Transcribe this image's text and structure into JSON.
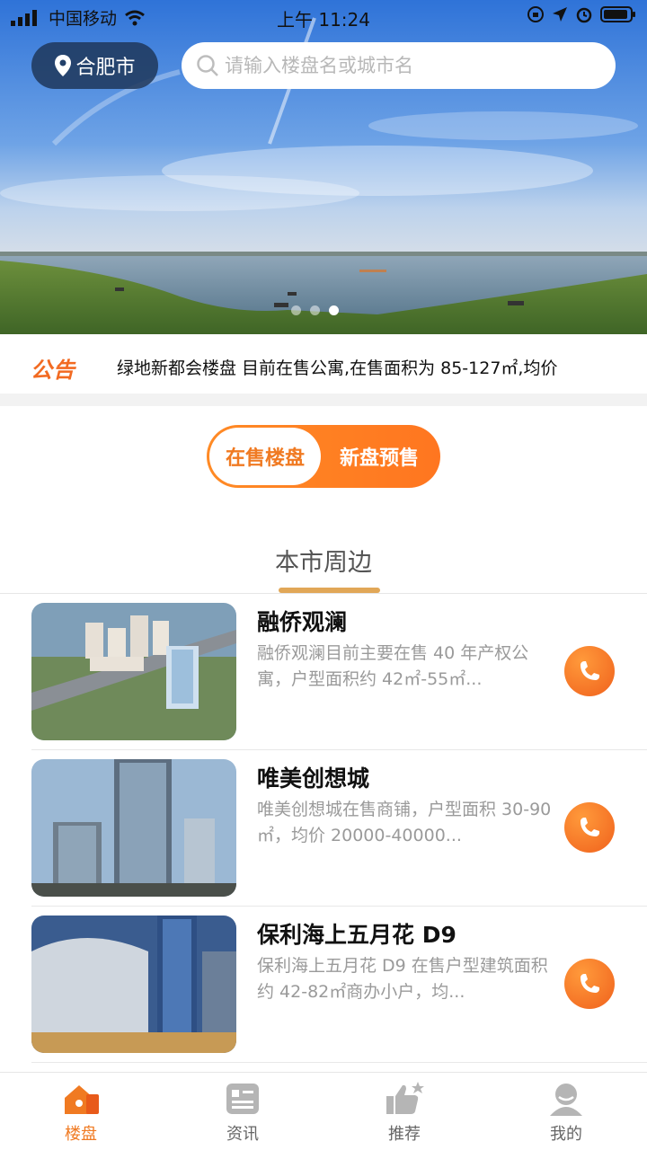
{
  "status_bar": {
    "carrier": "中国移动",
    "time": "上午 11:24"
  },
  "header": {
    "city": "合肥市",
    "search_placeholder": "请输入楼盘名或城市名"
  },
  "carousel": {
    "count": 3,
    "active_index": 2
  },
  "notice": {
    "badge": "公告",
    "text": "绿地新都会楼盘 目前在售公寓,在售面积为 85-127㎡,均价"
  },
  "toggle": {
    "on_sale": "在售楼盘",
    "presale": "新盘预售",
    "selected": "on_sale"
  },
  "section": {
    "title": "本市周边"
  },
  "listings": [
    {
      "title": "融侨观澜",
      "desc": "融侨观澜目前主要在售 40 年产权公寓，户型面积约 42㎡-55㎡...",
      "icon": "phone-icon"
    },
    {
      "title": "唯美创想城",
      "desc": "唯美创想城在售商铺，户型面积 30-90㎡，均价 20000-40000...",
      "icon": "phone-icon"
    },
    {
      "title": "保利海上五月花 D9",
      "desc": "保利海上五月花 D9 在售户型建筑面积约 42-82㎡商办小户，均...",
      "icon": "phone-icon"
    }
  ],
  "tabs": [
    {
      "label": "楼盘",
      "icon": "house-icon",
      "active": true
    },
    {
      "label": "资讯",
      "icon": "news-icon",
      "active": false
    },
    {
      "label": "推荐",
      "icon": "thumbs-up-icon",
      "active": false
    },
    {
      "label": "我的",
      "icon": "user-icon",
      "active": false
    }
  ],
  "colors": {
    "accent": "#f07a22",
    "accent_dark": "#f0611c",
    "underline": "#e1a757",
    "city_pill": "#1e375a"
  }
}
